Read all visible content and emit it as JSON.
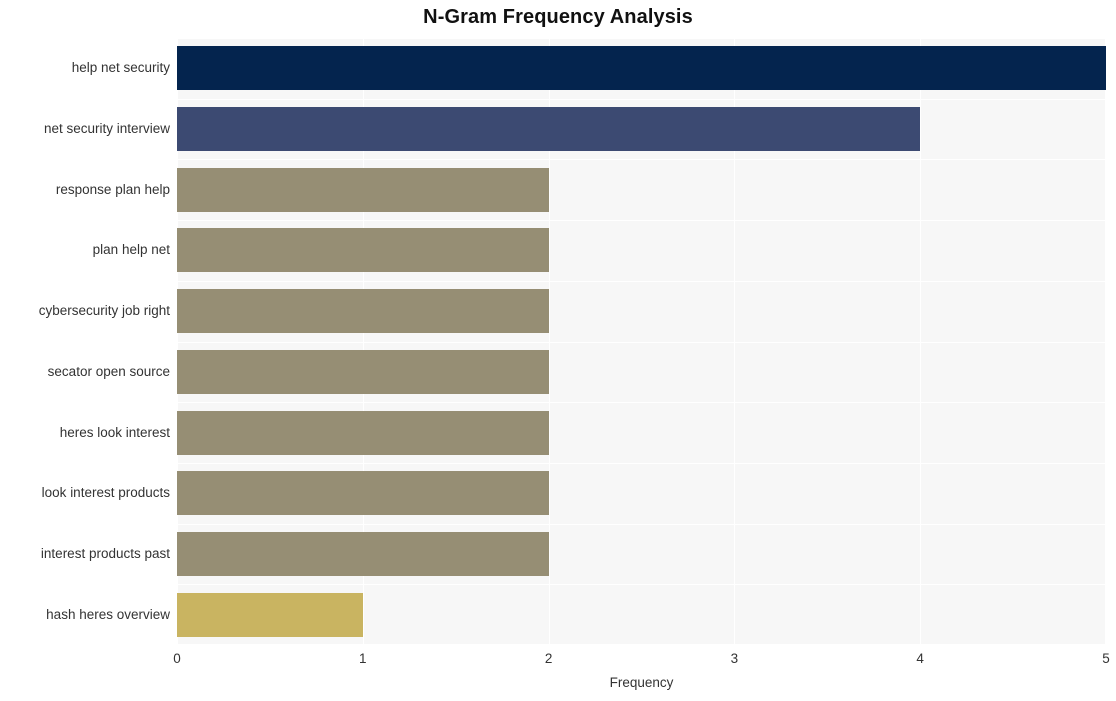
{
  "chart_data": {
    "type": "bar",
    "orientation": "horizontal",
    "title": "N-Gram Frequency Analysis",
    "xlabel": "Frequency",
    "ylabel": "",
    "categories": [
      "help net security",
      "net security interview",
      "response plan help",
      "plan help net",
      "cybersecurity job right",
      "secator open source",
      "heres look interest",
      "look interest products",
      "interest products past",
      "hash heres overview"
    ],
    "values": [
      5,
      4,
      2,
      2,
      2,
      2,
      2,
      2,
      2,
      1
    ],
    "bar_colors": [
      "#04244e",
      "#3c4a72",
      "#968e74",
      "#968e74",
      "#968e74",
      "#968e74",
      "#968e74",
      "#968e74",
      "#968e74",
      "#c9b461"
    ],
    "xlim": [
      0,
      5
    ],
    "x_ticks": [
      0,
      1,
      2,
      3,
      4,
      5
    ],
    "x_tick_labels": [
      "0",
      "1",
      "2",
      "3",
      "4",
      "5"
    ],
    "grid": true,
    "grid_color": "#ffffff",
    "plot_background": "#f7f7f7",
    "figure_background": "#ffffff",
    "legend": null
  }
}
